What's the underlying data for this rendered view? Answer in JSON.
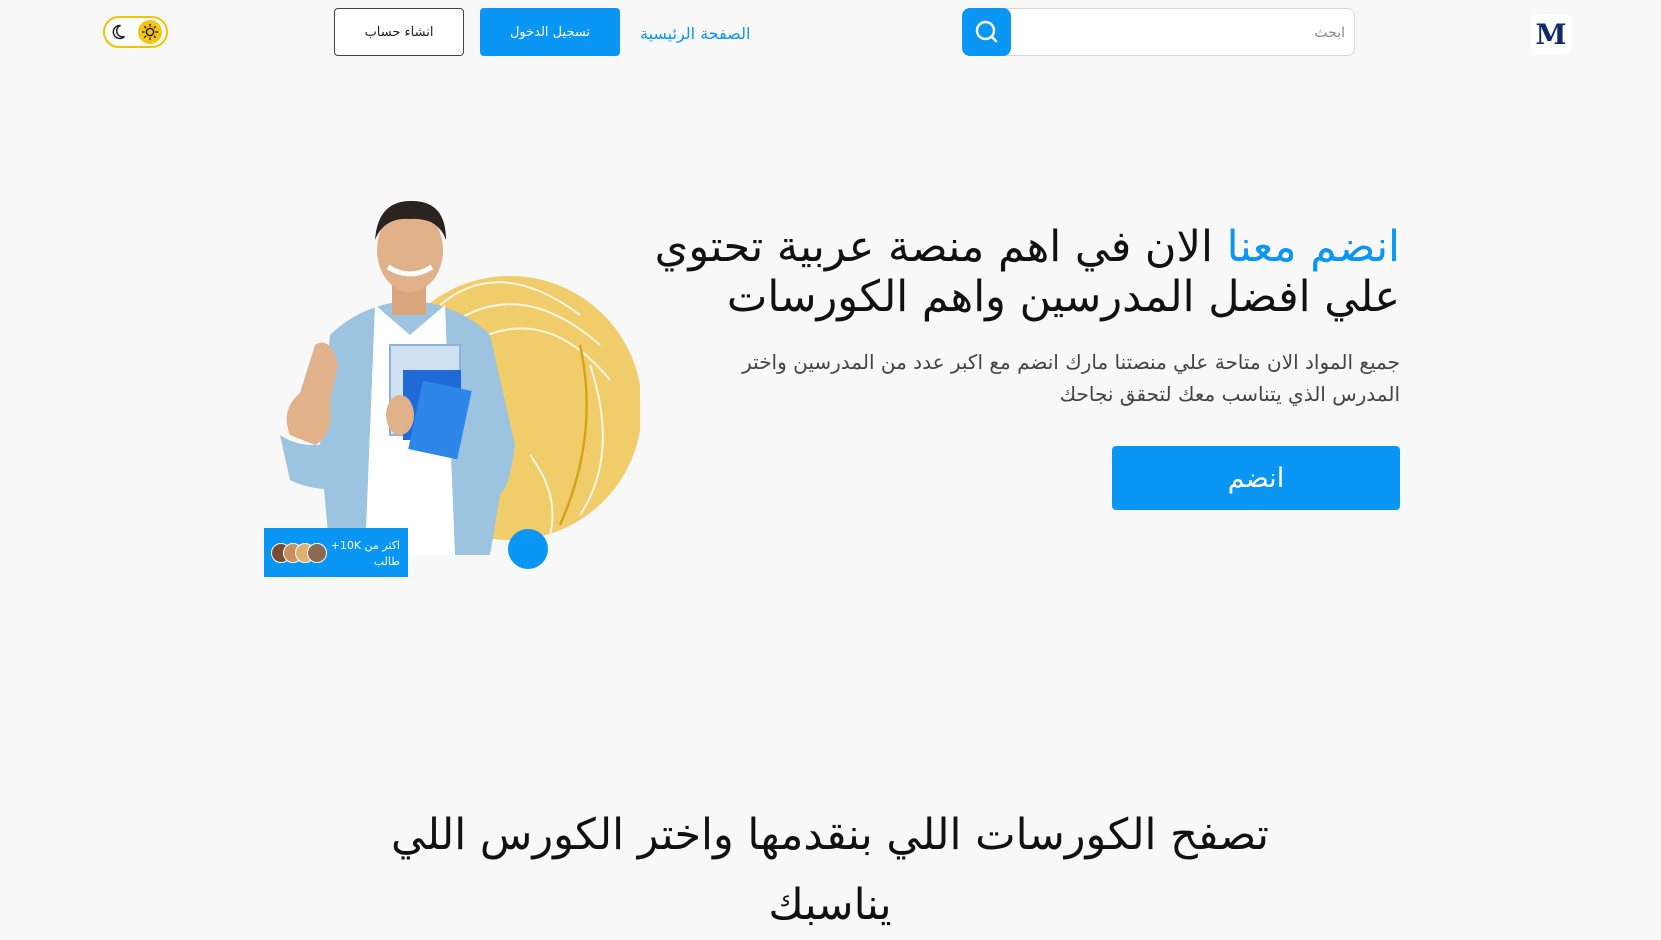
{
  "header": {
    "logo_letter": "M",
    "search": {
      "placeholder": "ابحث"
    },
    "nav_home": "الصفحة الرئيسية",
    "login_button": "تسجيل الدخول",
    "signup_button": "انشاء حساب",
    "theme": {
      "mode": "light",
      "icons": [
        "moon-icon",
        "sun-icon"
      ],
      "accent_color": "#f3c200"
    }
  },
  "hero": {
    "title_accent": "انضم معنا",
    "title_rest": " الان في اهم منصة عربية تحتوي علي افضل المدرسين واهم الكورسات",
    "description": "جميع المواد الان متاحة علي منصتنا مارك انضم مع اكبر عدد من المدرسين واختر المدرس الذي يتناسب معك لتحقق نجاحك",
    "join_button": "انضم",
    "stat_line1": "اكثر من 10K+",
    "stat_line2": "طالب"
  },
  "section": {
    "title": "تصفح الكورسات اللي بنقدمها واختر الكورس اللي يناسبك"
  },
  "colors": {
    "primary": "#0a96f5",
    "background": "#f8f8f9",
    "blob": "#f0cd6a"
  }
}
